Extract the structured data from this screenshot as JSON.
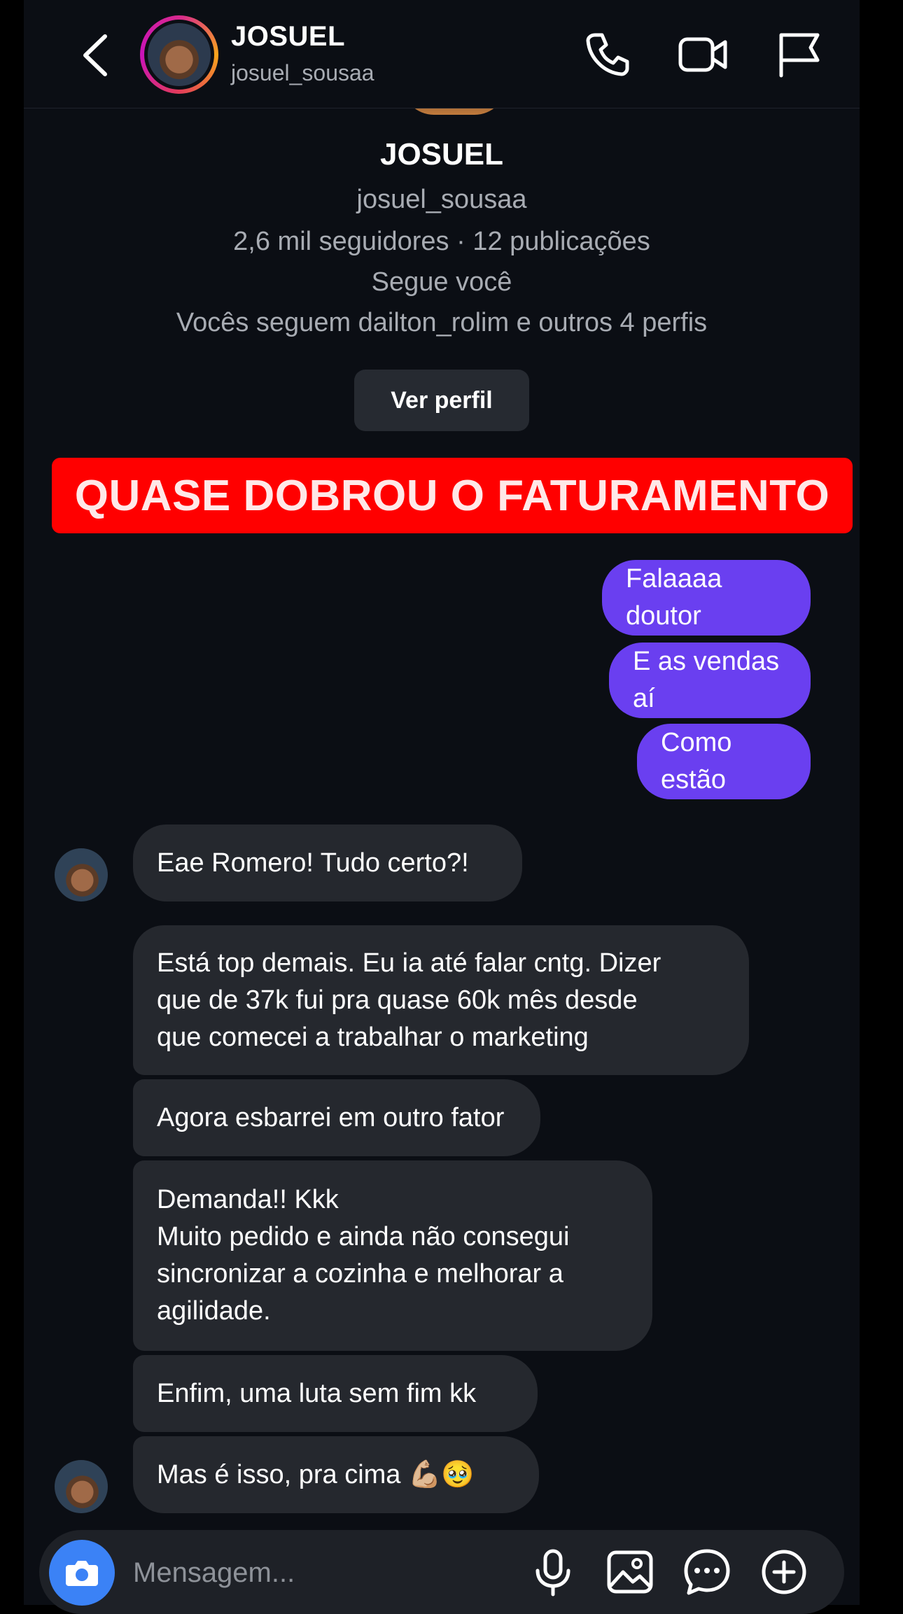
{
  "header": {
    "name": "JOSUEL",
    "username": "josuel_sousaa"
  },
  "profile": {
    "name": "JOSUEL",
    "username": "josuel_sousaa",
    "stats": "2,6 mil seguidores · 12 publicações",
    "follows_you": "Segue você",
    "mutuals": "Vocês seguem dailton_rolim e outros 4 perfis",
    "view_profile_label": "Ver perfil"
  },
  "banner": {
    "text": "QUASE DOBROU O FATURAMENTO",
    "color": "#ff0000"
  },
  "messages": {
    "sent": [
      "Falaaaa doutor",
      "E as vendas aí",
      "Como estão"
    ],
    "received": [
      "Eae Romero! Tudo certo?!",
      "Está top demais. Eu ia até falar cntg. Dizer\nque de 37k fui pra quase 60k mês desde\nque comecei a trabalhar o marketing",
      "Agora esbarrei em outro fator",
      "Demanda!! Kkk\nMuito pedido e ainda não consegui\nsincronizar a cozinha e melhorar a\nagilidade.",
      "Enfim, uma luta sem fim kk",
      "Mas é isso, pra cima 💪🏼🥹"
    ]
  },
  "composer": {
    "placeholder": "Mensagem..."
  },
  "colors": {
    "background": "#0b0e14",
    "sent_bubble": "#6a3ff0",
    "received_bubble": "#25282e",
    "camera_button": "#3b82f6"
  },
  "icons": [
    "back-arrow-icon",
    "phone-icon",
    "video-camera-icon",
    "flag-icon",
    "camera-icon",
    "microphone-icon",
    "gallery-icon",
    "sticker-icon",
    "plus-circle-icon"
  ]
}
